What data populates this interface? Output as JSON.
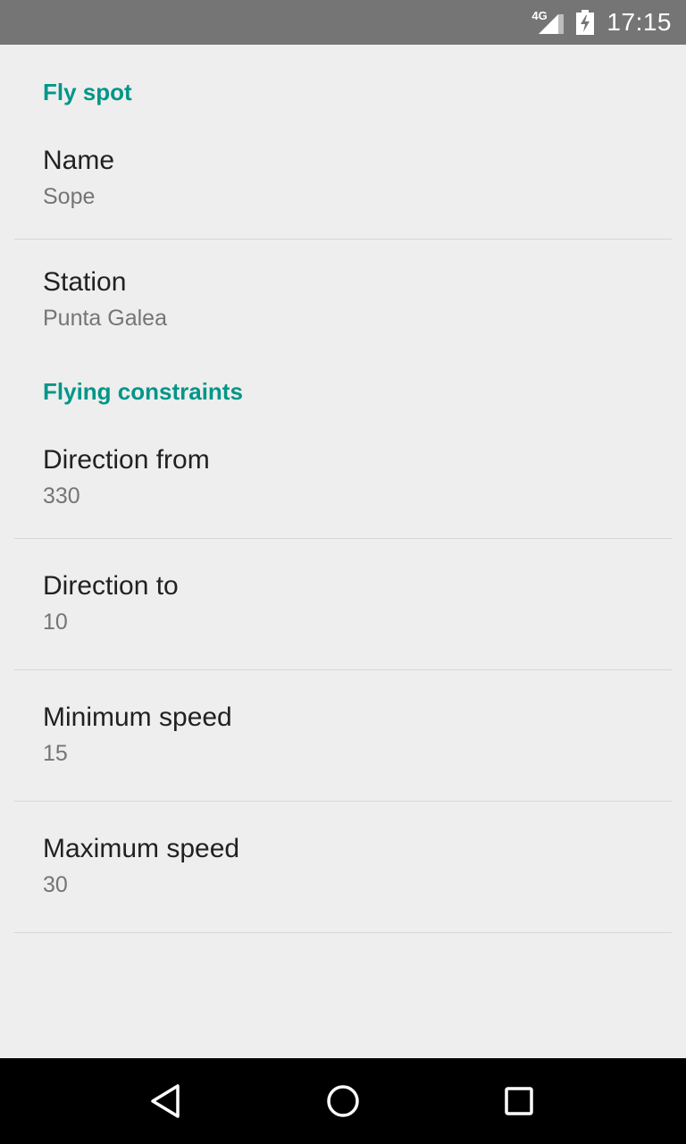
{
  "status_bar": {
    "network_label": "4G",
    "time": "17:15"
  },
  "sections": [
    {
      "header": "Fly spot",
      "items": [
        {
          "title": "Name",
          "summary": "Sope"
        },
        {
          "title": "Station",
          "summary": "Punta Galea"
        }
      ]
    },
    {
      "header": "Flying constraints",
      "items": [
        {
          "title": "Direction from",
          "summary": "330"
        },
        {
          "title": "Direction to",
          "summary": "10"
        },
        {
          "title": "Minimum speed",
          "summary": "15"
        },
        {
          "title": "Maximum speed",
          "summary": "30"
        }
      ]
    }
  ],
  "nav_bar": {
    "icons": [
      "back-icon",
      "home-icon",
      "recents-icon"
    ]
  },
  "colors": {
    "accent": "#009688",
    "status_bar": "#757575",
    "background": "#eeeeee"
  }
}
